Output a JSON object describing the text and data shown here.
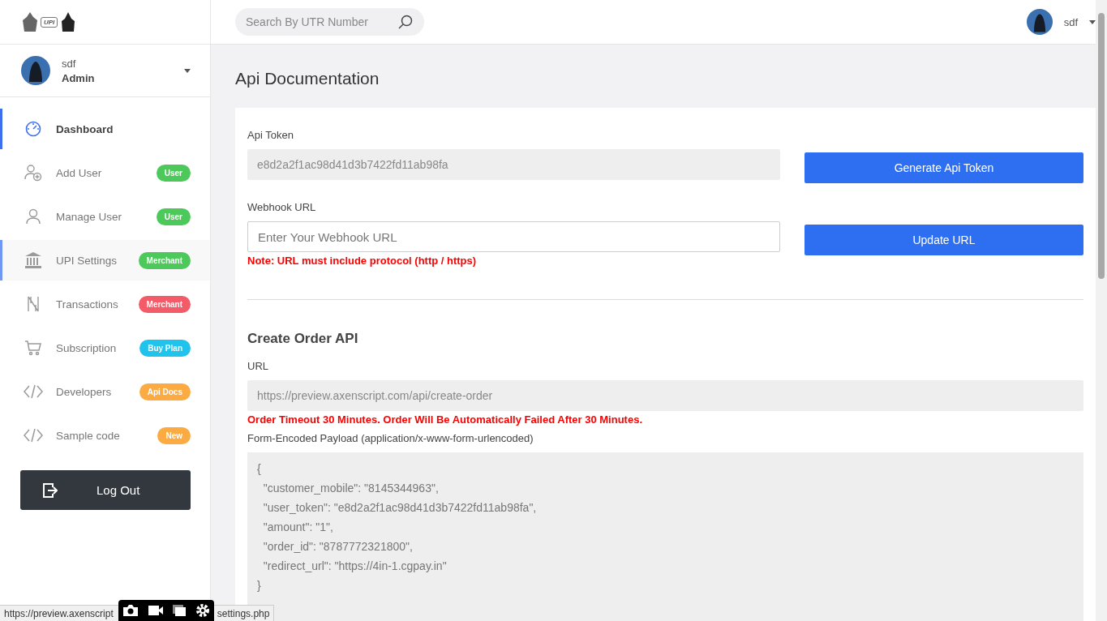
{
  "logo": {
    "text": "UPI"
  },
  "user": {
    "name": "sdf",
    "role": "Admin"
  },
  "sidebar": {
    "items": [
      {
        "label": "Dashboard",
        "selected": true,
        "highlighted": false
      },
      {
        "label": "Add User",
        "badge": "User",
        "color": "#4cc95a",
        "selected": false,
        "highlighted": false
      },
      {
        "label": "Manage User",
        "badge": "User",
        "color": "#4cc95a",
        "selected": false,
        "highlighted": false
      },
      {
        "label": "UPI Settings",
        "badge": "Merchant",
        "color": "#4cc95a",
        "selected": false,
        "highlighted": true
      },
      {
        "label": "Transactions",
        "badge": "Merchant",
        "color": "#f45b69",
        "selected": false,
        "highlighted": false
      },
      {
        "label": "Subscription",
        "badge": "Buy Plan",
        "color": "#1fc3ec",
        "selected": false,
        "highlighted": false
      },
      {
        "label": "Developers",
        "badge": "Api Docs",
        "color": "#fbab41",
        "selected": false,
        "highlighted": false
      },
      {
        "label": "Sample code",
        "badge": "New",
        "color": "#fbab41",
        "selected": false,
        "highlighted": false
      }
    ],
    "logout": "Log Out"
  },
  "header": {
    "search": {
      "placeholder": "Search By UTR Number"
    },
    "user": "sdf"
  },
  "page_title": "Api Documentation",
  "token": {
    "label": "Api Token",
    "value": "e8d2a2f1ac98d41d3b7422fd11ab98fa",
    "button": "Generate Api Token"
  },
  "webhook": {
    "label": "Webhook URL",
    "placeholder": "Enter Your Webhook URL",
    "note": "Note: URL must include protocol (http / https)",
    "button": "Update URL"
  },
  "create_order": {
    "title": "Create Order API",
    "url_label": "URL",
    "url": "https://preview.axenscript.com/api/create-order",
    "warning": "Order Timeout 30 Minutes. Order Will Be Automatically Failed After 30 Minutes.",
    "payload_label": "Form-Encoded Payload (application/x-www-form-urlencoded)",
    "payload_lines": [
      "{",
      "  \"customer_mobile\": \"8145344963\",",
      "  \"user_token\": \"e8d2a2f1ac98d41d3b7422fd11ab98fa\",",
      "  \"amount\": \"1\",",
      "  \"order_id\": \"8787772321800\",",
      "  \"redirect_url\": \"https://4in-1.cgpay.in\"",
      "}"
    ]
  },
  "status_bar": {
    "url_start": "https://preview.axenscript",
    "url_end": "settings.php"
  }
}
